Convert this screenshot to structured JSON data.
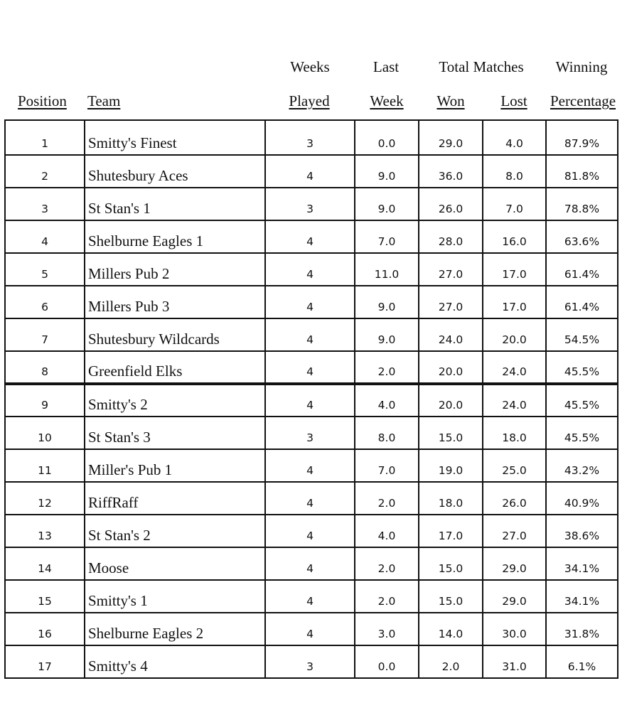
{
  "headers": {
    "position": "Position",
    "team": "Team",
    "weeks_played_top": "Weeks",
    "weeks_played_bottom": "Played",
    "last_week_top": "Last",
    "last_week_bottom": "Week",
    "total_matches": "Total Matches",
    "won": "Won",
    "lost": "Lost",
    "winning_top": "Winning",
    "winning_bottom": "Percentage"
  },
  "rows": [
    {
      "position": "1",
      "team": "Smitty's Finest",
      "weeks_played": "3",
      "last_week": "0.0",
      "won": "29.0",
      "lost": "4.0",
      "pct": "87.9%"
    },
    {
      "position": "2",
      "team": "Shutesbury Aces",
      "weeks_played": "4",
      "last_week": "9.0",
      "won": "36.0",
      "lost": "8.0",
      "pct": "81.8%"
    },
    {
      "position": "3",
      "team": "St Stan's 1",
      "weeks_played": "3",
      "last_week": "9.0",
      "won": "26.0",
      "lost": "7.0",
      "pct": "78.8%"
    },
    {
      "position": "4",
      "team": "Shelburne Eagles 1",
      "weeks_played": "4",
      "last_week": "7.0",
      "won": "28.0",
      "lost": "16.0",
      "pct": "63.6%"
    },
    {
      "position": "5",
      "team": "Millers Pub 2",
      "weeks_played": "4",
      "last_week": "11.0",
      "won": "27.0",
      "lost": "17.0",
      "pct": "61.4%"
    },
    {
      "position": "6",
      "team": "Millers Pub 3",
      "weeks_played": "4",
      "last_week": "9.0",
      "won": "27.0",
      "lost": "17.0",
      "pct": "61.4%"
    },
    {
      "position": "7",
      "team": "Shutesbury Wildcards",
      "weeks_played": "4",
      "last_week": "9.0",
      "won": "24.0",
      "lost": "20.0",
      "pct": "54.5%"
    },
    {
      "position": "8",
      "team": "Greenfield Elks",
      "weeks_played": "4",
      "last_week": "2.0",
      "won": "20.0",
      "lost": "24.0",
      "pct": "45.5%"
    },
    {
      "position": "9",
      "team": "Smitty's 2",
      "weeks_played": "4",
      "last_week": "4.0",
      "won": "20.0",
      "lost": "24.0",
      "pct": "45.5%"
    },
    {
      "position": "10",
      "team": "St Stan's 3",
      "weeks_played": "3",
      "last_week": "8.0",
      "won": "15.0",
      "lost": "18.0",
      "pct": "45.5%"
    },
    {
      "position": "11",
      "team": "Miller's Pub 1",
      "weeks_played": "4",
      "last_week": "7.0",
      "won": "19.0",
      "lost": "25.0",
      "pct": "43.2%"
    },
    {
      "position": "12",
      "team": "RiffRaff",
      "weeks_played": "4",
      "last_week": "2.0",
      "won": "18.0",
      "lost": "26.0",
      "pct": "40.9%"
    },
    {
      "position": "13",
      "team": "St Stan's 2",
      "weeks_played": "4",
      "last_week": "4.0",
      "won": "17.0",
      "lost": "27.0",
      "pct": "38.6%"
    },
    {
      "position": "14",
      "team": "Moose",
      "weeks_played": "4",
      "last_week": "2.0",
      "won": "15.0",
      "lost": "29.0",
      "pct": "34.1%"
    },
    {
      "position": "15",
      "team": "Smitty's 1",
      "weeks_played": "4",
      "last_week": "2.0",
      "won": "15.0",
      "lost": "29.0",
      "pct": "34.1%"
    },
    {
      "position": "16",
      "team": "Shelburne Eagles 2",
      "weeks_played": "4",
      "last_week": "3.0",
      "won": "14.0",
      "lost": "30.0",
      "pct": "31.8%"
    },
    {
      "position": "17",
      "team": "Smitty's 4",
      "weeks_played": "3",
      "last_week": "0.0",
      "won": "2.0",
      "lost": "31.0",
      "pct": "6.1%"
    }
  ]
}
